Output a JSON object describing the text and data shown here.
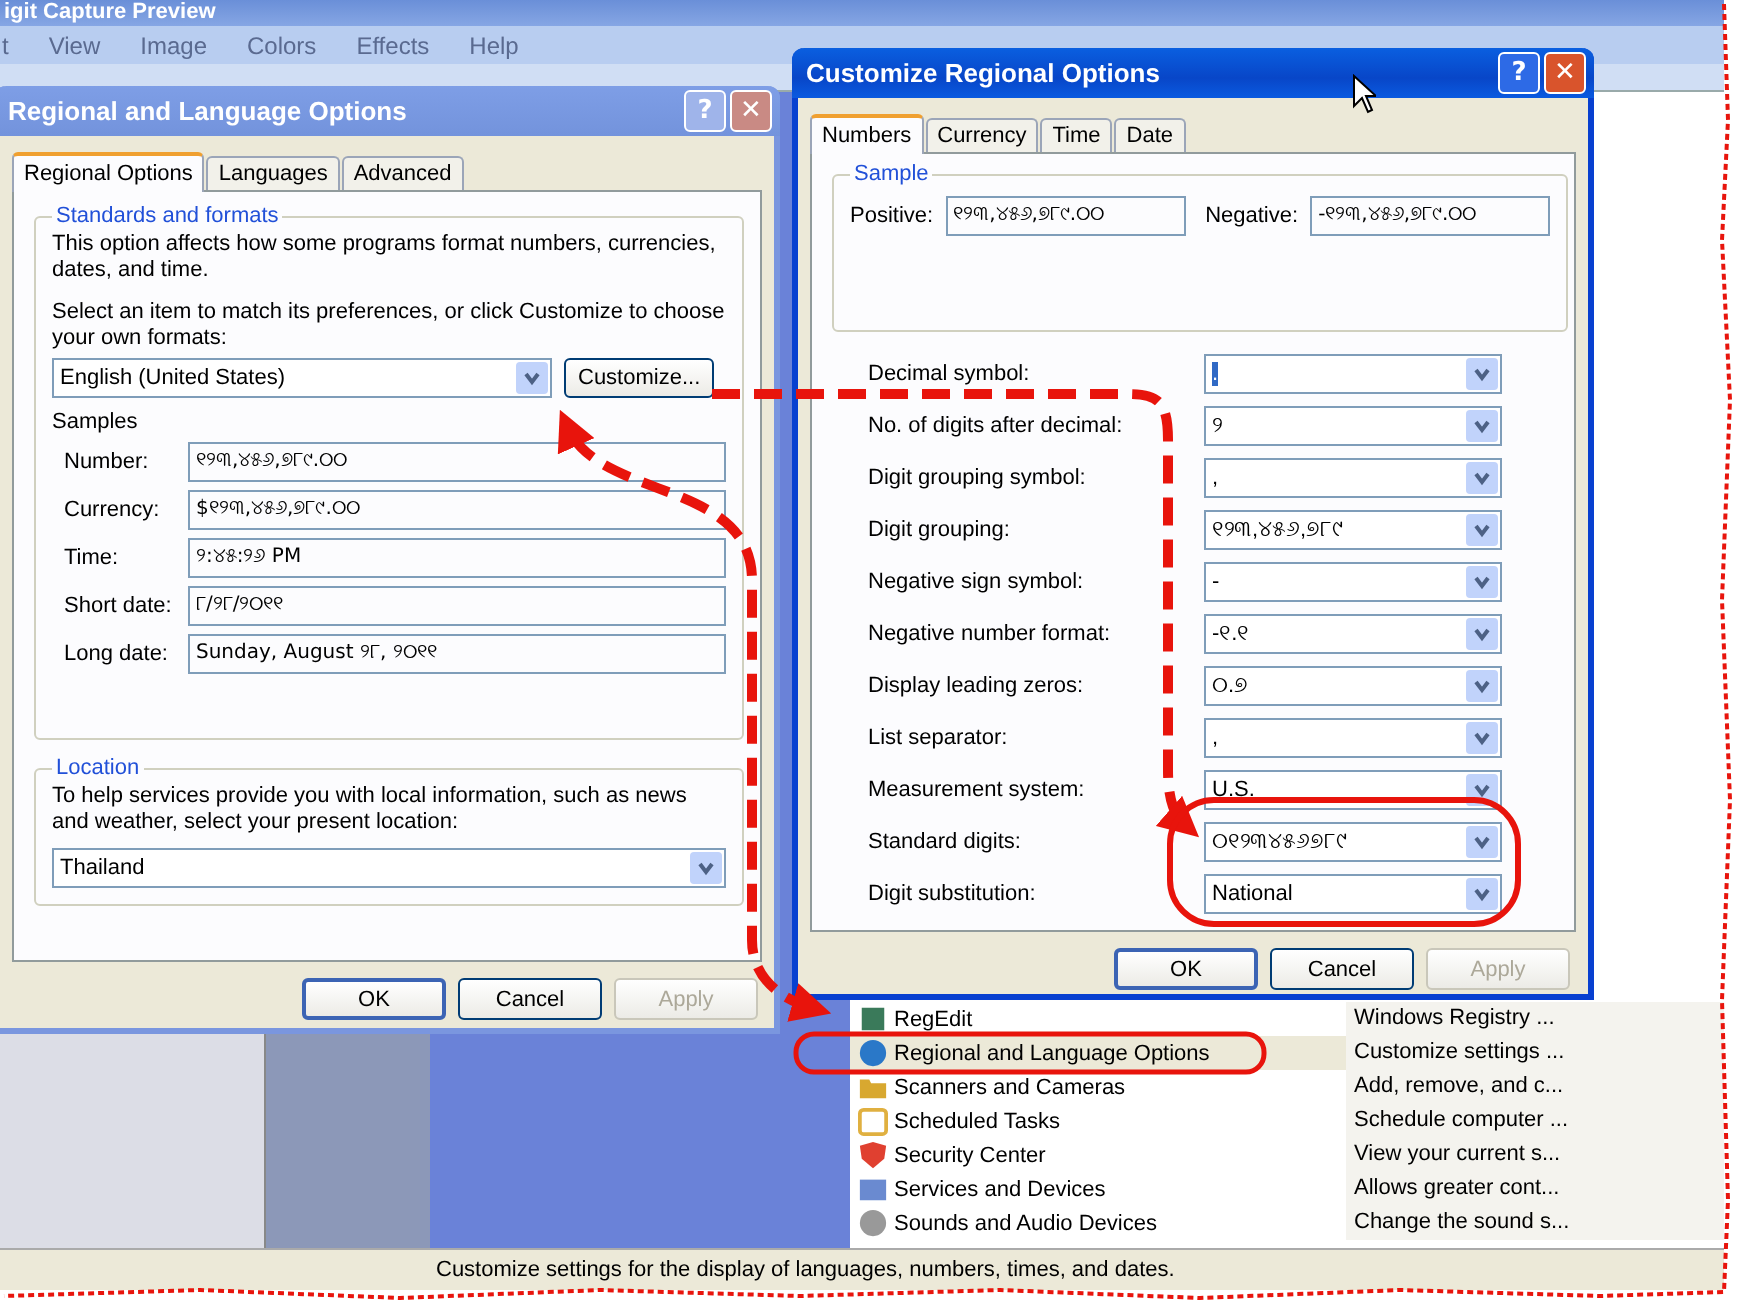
{
  "background_app": {
    "title": "igit Capture Preview",
    "menu": [
      "t",
      "View",
      "Image",
      "Colors",
      "Effects",
      "Help"
    ]
  },
  "control_panel": {
    "items": [
      {
        "name": "RegEdit",
        "description": "Windows Registry ...",
        "selected": false
      },
      {
        "name": "Regional and Language Options",
        "description": "Customize settings ...",
        "selected": true
      },
      {
        "name": "Scanners and Cameras",
        "description": "Add, remove, and c...",
        "selected": false
      },
      {
        "name": "Scheduled Tasks",
        "description": "Schedule computer ...",
        "selected": false
      },
      {
        "name": "Security Center",
        "description": "View your current s...",
        "selected": false
      },
      {
        "name": "Services and Devices",
        "description": "Allows greater cont...",
        "selected": false
      },
      {
        "name": "Sounds and Audio Devices",
        "description": "Change the sound s...",
        "selected": false
      }
    ],
    "status_bar": "Customize settings for the display of languages, numbers, times, and dates."
  },
  "regional_dialog": {
    "title": "Regional and Language Options",
    "active": false,
    "help": "?",
    "close": "✕",
    "tabs": [
      {
        "label": "Regional Options",
        "selected": true
      },
      {
        "label": "Languages",
        "selected": false
      },
      {
        "label": "Advanced",
        "selected": false
      }
    ],
    "standards": {
      "title": "Standards and formats",
      "description": "This option affects how some programs format numbers, currencies, dates, and time.",
      "prompt": "Select an item to match its preferences, or click Customize to choose your own formats:",
      "format": "English (United States)",
      "customize": "Customize...",
      "samples_title": "Samples",
      "samples": [
        {
          "label": "Number:",
          "value": "୧୨୩,୪୫୬,୭୮୯.୦୦"
        },
        {
          "label": "Currency:",
          "value": "$୧୨୩,୪୫୬,୭୮୯.୦୦"
        },
        {
          "label": "Time:",
          "value": "୨:୪୫:୨୬ PM"
        },
        {
          "label": "Short date:",
          "value": "୮/୨୮/୨୦୧୧"
        },
        {
          "label": "Long date:",
          "value": "Sunday, August ୨୮, ୨୦୧୧"
        }
      ]
    },
    "location": {
      "title": "Location",
      "description": "To help services provide you with local information, such as news and weather, select your present location:",
      "value": "Thailand"
    },
    "buttons": [
      {
        "label": "OK",
        "default": true,
        "disabled": false
      },
      {
        "label": "Cancel",
        "default": false,
        "disabled": false
      },
      {
        "label": "Apply",
        "default": false,
        "disabled": true
      }
    ]
  },
  "customize_dialog": {
    "title": "Customize Regional Options",
    "active": true,
    "help": "?",
    "close": "✕",
    "tabs": [
      {
        "label": "Numbers",
        "selected": true
      },
      {
        "label": "Currency",
        "selected": false
      },
      {
        "label": "Time",
        "selected": false
      },
      {
        "label": "Date",
        "selected": false
      }
    ],
    "sample": {
      "title": "Sample",
      "positive_label": "Positive:",
      "positive": "୧୨୩,୪୫୬,୭୮୯.୦୦",
      "negative_label": "Negative:",
      "negative": "-୧୨୩,୪୫୬,୭୮୯.୦୦"
    },
    "settings": [
      {
        "label": "Decimal symbol:",
        "value": ".",
        "text_selected": true
      },
      {
        "label": "No. of digits after decimal:",
        "value": "୨",
        "text_selected": false
      },
      {
        "label": "Digit grouping symbol:",
        "value": ",",
        "text_selected": false
      },
      {
        "label": "Digit grouping:",
        "value": "୧୨୩,୪୫୬,୭୮୯",
        "text_selected": false
      },
      {
        "label": "Negative sign symbol:",
        "value": "-",
        "text_selected": false
      },
      {
        "label": "Negative number format:",
        "value": "-୧.୧",
        "text_selected": false
      },
      {
        "label": "Display leading zeros:",
        "value": "୦.୭",
        "text_selected": false
      },
      {
        "label": "List separator:",
        "value": ",",
        "text_selected": false
      },
      {
        "label": "Measurement system:",
        "value": "U.S.",
        "text_selected": false
      },
      {
        "label": "Standard digits:",
        "value": "୦୧୨୩୪୫୬୭୮୯",
        "text_selected": false
      },
      {
        "label": "Digit substitution:",
        "value": "National",
        "text_selected": false
      }
    ],
    "buttons": [
      {
        "label": "OK",
        "default": true,
        "disabled": false
      },
      {
        "label": "Cancel",
        "default": false,
        "disabled": false
      },
      {
        "label": "Apply",
        "default": false,
        "disabled": true
      }
    ]
  }
}
